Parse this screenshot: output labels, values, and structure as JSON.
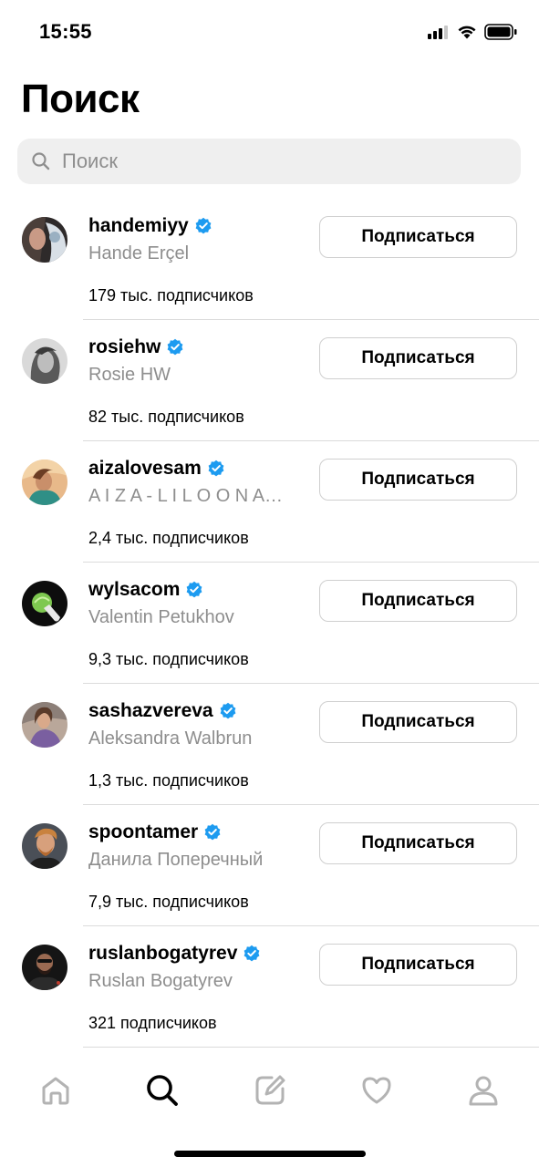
{
  "status_bar": {
    "time": "15:55"
  },
  "header": {
    "title": "Поиск"
  },
  "search": {
    "placeholder": "Поиск"
  },
  "results": [
    {
      "username": "handemiyy",
      "full_name": "Hande Erçel",
      "followers": "179 тыс. подписчиков",
      "button": "Подписаться",
      "verified": true
    },
    {
      "username": "rosiehw",
      "full_name": "Rosie HW",
      "followers": "82 тыс. подписчиков",
      "button": "Подписаться",
      "verified": true
    },
    {
      "username": "aizalovesam",
      "full_name": "A I Z A - L I L O O N A…",
      "followers": "2,4 тыс. подписчиков",
      "button": "Подписаться",
      "verified": true
    },
    {
      "username": "wylsacom",
      "full_name": "Valentin Petukhov",
      "followers": "9,3 тыс. подписчиков",
      "button": "Подписаться",
      "verified": true
    },
    {
      "username": "sashazvereva",
      "full_name": "Aleksandra Walbrun",
      "followers": "1,3 тыс. подписчиков",
      "button": "Подписаться",
      "verified": true
    },
    {
      "username": "spoontamer",
      "full_name": "Данила Поперечный",
      "followers": "7,9 тыс. подписчиков",
      "button": "Подписаться",
      "verified": true
    },
    {
      "username": "ruslanbogatyrev",
      "full_name": "Ruslan Bogatyrev",
      "followers": "321 подписчиков",
      "button": "Подписаться",
      "verified": true
    }
  ],
  "tab_bar": {
    "items": [
      {
        "icon": "home-icon",
        "active": false
      },
      {
        "icon": "search-icon",
        "active": true
      },
      {
        "icon": "compose-icon",
        "active": false
      },
      {
        "icon": "heart-icon",
        "active": false
      },
      {
        "icon": "profile-icon",
        "active": false
      }
    ]
  },
  "colors": {
    "verified": "#1d9bf0",
    "secondary_text": "#8e8e8e",
    "divider": "#dbdbdb",
    "search_bg": "#efefef"
  }
}
